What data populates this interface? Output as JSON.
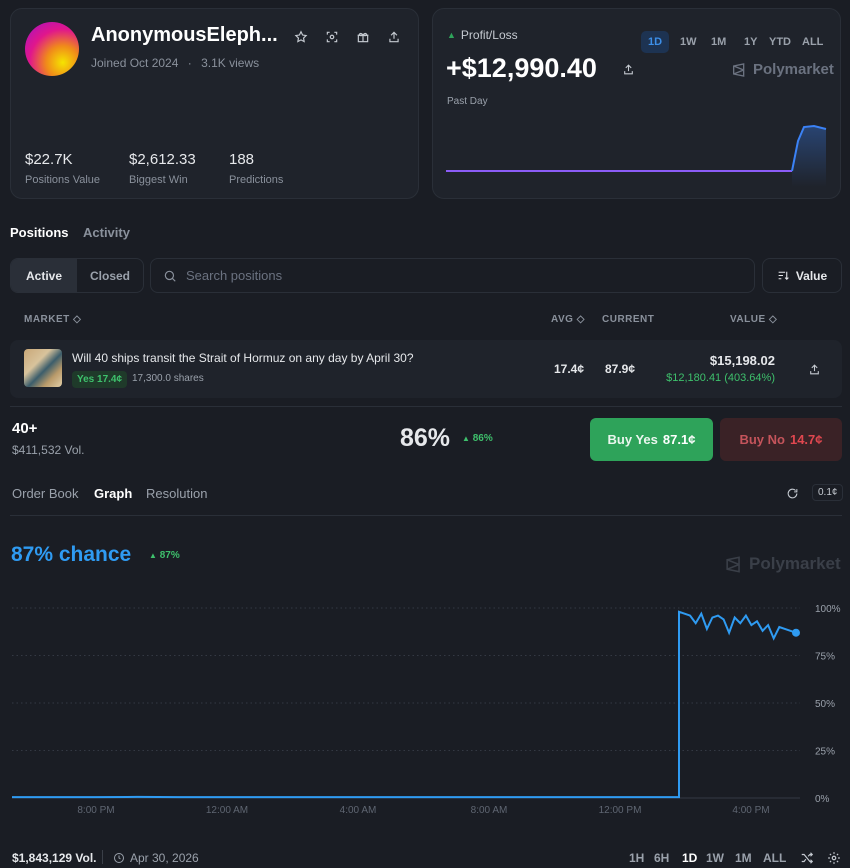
{
  "profile": {
    "username": "AnonymousEleph...",
    "joined": "Joined Oct 2024",
    "views": "3.1K views",
    "stats": [
      {
        "value": "$22.7K",
        "label": "Positions Value"
      },
      {
        "value": "$2,612.33",
        "label": "Biggest Win"
      },
      {
        "value": "188",
        "label": "Predictions"
      }
    ],
    "action_icons": [
      "star-icon",
      "scan-icon",
      "gift-icon",
      "share-icon"
    ]
  },
  "pnl": {
    "label": "Profit/Loss",
    "amount": "+$12,990.40",
    "period_caption": "Past Day",
    "brand": "Polymarket",
    "periods": [
      "1D",
      "1W",
      "1M",
      "1Y",
      "YTD",
      "ALL"
    ],
    "active_period": "1D",
    "colors": {
      "line": "#8b5cf6",
      "spike": "#3b82f6"
    }
  },
  "tabs": {
    "positions": "Positions",
    "activity": "Activity",
    "active_tab": "Positions"
  },
  "filter": {
    "active": "Active",
    "closed": "Closed",
    "search_placeholder": "Search positions",
    "sort_label": "Value"
  },
  "table": {
    "headers": {
      "market": "MARKET",
      "avg": "AVG",
      "current": "CURRENT",
      "value": "VALUE"
    },
    "row": {
      "title": "Will 40 ships transit the Strait of Hormuz on any day by April 30?",
      "badge": "Yes 17.4¢",
      "shares": "17,300.0 shares",
      "avg": "17.4¢",
      "current": "87.9¢",
      "value": "$15,198.02",
      "pnl": "$12,180.41 (403.64%)"
    }
  },
  "market": {
    "outcome": "40+",
    "volume": "$411,532 Vol.",
    "chance": "86%",
    "chance_delta": "86%",
    "buy_yes_label": "Buy Yes",
    "buy_yes_price": "87.1¢",
    "buy_no_label": "Buy No",
    "buy_no_price": "14.7¢",
    "colors": {
      "yes": "#2ea35a",
      "no": "#3a2226",
      "no_text": "#e0474f"
    }
  },
  "subtabs": {
    "order_book": "Order Book",
    "graph": "Graph",
    "resolution": "Resolution",
    "active": "Graph",
    "tick": "0.1¢"
  },
  "graph": {
    "headline": "87% chance",
    "delta": "87%",
    "brand": "Polymarket",
    "colors": {
      "line": "#2f9bf2",
      "headline": "#2f9bf2"
    }
  },
  "chart_data": {
    "type": "line",
    "x_ticks": [
      "8:00 PM",
      "12:00 AM",
      "4:00 AM",
      "8:00 AM",
      "12:00 PM",
      "4:00 PM"
    ],
    "y_ticks": [
      "100%",
      "75%",
      "50%",
      "25%",
      "0%"
    ],
    "ylim": [
      0,
      100
    ],
    "grid": true,
    "series": [
      {
        "values_pct": [
          0.5,
          0.5,
          0.5,
          0.6,
          0.5,
          0.5,
          0.5,
          0.5,
          0.5,
          0.5,
          0.5,
          0.5,
          0.5,
          0.5,
          0.5,
          0.5,
          0.5,
          98,
          97,
          96,
          92,
          97,
          89,
          95,
          96,
          94,
          87,
          95,
          92,
          96,
          91,
          93,
          88,
          91,
          84,
          90,
          89,
          88,
          87
        ]
      }
    ]
  },
  "footer": {
    "volume": "$1,843,129 Vol.",
    "date": "Apr 30, 2026",
    "ranges": [
      "1H",
      "6H",
      "1D",
      "1W",
      "1M",
      "ALL"
    ],
    "active_range": "1D"
  }
}
